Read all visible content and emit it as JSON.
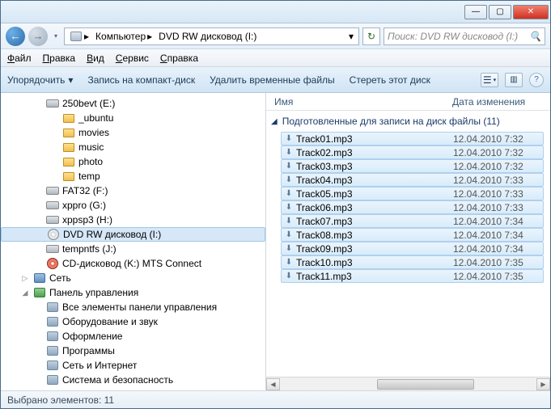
{
  "titlebar": {
    "min": "—",
    "max": "▢",
    "close": "✕"
  },
  "nav": {
    "back": "←",
    "fwd": "→",
    "dd": "▾",
    "sep": "▸",
    "crumb_root_icon": "🖥",
    "crumb1": "Компьютер",
    "crumb2": "DVD RW дисковод (I:)",
    "addr_dd": "▾",
    "refresh": "↻",
    "search_placeholder": "Поиск: DVD RW дисковод (I:)",
    "search_icon": "🔍"
  },
  "menu": {
    "file": "Файл",
    "file_u": "Ф",
    "edit": "Правка",
    "edit_u": "П",
    "view": "Вид",
    "view_u": "В",
    "tools": "Сервис",
    "tools_u": "С",
    "help": "Справка",
    "help_u": "С"
  },
  "toolbar": {
    "organize": "Упорядочить",
    "burn": "Запись на компакт-диск",
    "deltemp": "Удалить временные файлы",
    "erase": "Стереть этот диск",
    "dd": "▾",
    "viewico": "☰",
    "previco": "▥",
    "helpico": "?"
  },
  "tree": [
    {
      "pad": 40,
      "expand": "",
      "iconClass": "i-drive",
      "label": "250bevt (E:)"
    },
    {
      "pad": 60,
      "expand": "",
      "iconClass": "i-fold",
      "label": "_ubuntu"
    },
    {
      "pad": 60,
      "expand": "",
      "iconClass": "i-fold",
      "label": "movies"
    },
    {
      "pad": 60,
      "expand": "",
      "iconClass": "i-fold",
      "label": "music"
    },
    {
      "pad": 60,
      "expand": "",
      "iconClass": "i-fold",
      "label": "photo"
    },
    {
      "pad": 60,
      "expand": "",
      "iconClass": "i-fold",
      "label": "temp"
    },
    {
      "pad": 40,
      "expand": "",
      "iconClass": "i-drive",
      "label": "FAT32 (F:)"
    },
    {
      "pad": 40,
      "expand": "",
      "iconClass": "i-drive",
      "label": "xppro (G:)"
    },
    {
      "pad": 40,
      "expand": "",
      "iconClass": "i-drive",
      "label": "xppsp3 (H:)"
    },
    {
      "pad": 40,
      "expand": "",
      "iconClass": "i-disc",
      "label": "DVD RW дисковод (I:)",
      "sel": true
    },
    {
      "pad": 40,
      "expand": "",
      "iconClass": "i-drive",
      "label": "tempntfs (J:)"
    },
    {
      "pad": 40,
      "expand": "",
      "iconClass": "i-discr",
      "label": "CD-дисковод (K:) MTS Connect"
    },
    {
      "pad": 24,
      "expand": "▷",
      "iconClass": "i-net",
      "label": "Сеть"
    },
    {
      "pad": 24,
      "expand": "◢",
      "iconClass": "i-cp",
      "label": "Панель управления"
    },
    {
      "pad": 40,
      "expand": "",
      "iconClass": "i-gen",
      "label": "Все элементы панели управления"
    },
    {
      "pad": 40,
      "expand": "",
      "iconClass": "i-gen",
      "label": "Оборудование и звук"
    },
    {
      "pad": 40,
      "expand": "",
      "iconClass": "i-gen",
      "label": "Оформление"
    },
    {
      "pad": 40,
      "expand": "",
      "iconClass": "i-gen",
      "label": "Программы"
    },
    {
      "pad": 40,
      "expand": "",
      "iconClass": "i-gen",
      "label": "Сеть и Интернет"
    },
    {
      "pad": 40,
      "expand": "",
      "iconClass": "i-gen",
      "label": "Система и безопасность"
    }
  ],
  "columns": {
    "name": "Имя",
    "date": "Дата изменения"
  },
  "group": {
    "arrow": "◢",
    "label": "Подготовленные для записи на диск файлы (11)"
  },
  "files": [
    {
      "icon": "⬇",
      "name": "Track01.mp3",
      "date": "12.04.2010 7:32"
    },
    {
      "icon": "⬇",
      "name": "Track02.mp3",
      "date": "12.04.2010 7:32"
    },
    {
      "icon": "⬇",
      "name": "Track03.mp3",
      "date": "12.04.2010 7:32"
    },
    {
      "icon": "⬇",
      "name": "Track04.mp3",
      "date": "12.04.2010 7:33"
    },
    {
      "icon": "⬇",
      "name": "Track05.mp3",
      "date": "12.04.2010 7:33"
    },
    {
      "icon": "⬇",
      "name": "Track06.mp3",
      "date": "12.04.2010 7:33"
    },
    {
      "icon": "⬇",
      "name": "Track07.mp3",
      "date": "12.04.2010 7:34"
    },
    {
      "icon": "⬇",
      "name": "Track08.mp3",
      "date": "12.04.2010 7:34"
    },
    {
      "icon": "⬇",
      "name": "Track09.mp3",
      "date": "12.04.2010 7:34"
    },
    {
      "icon": "⬇",
      "name": "Track10.mp3",
      "date": "12.04.2010 7:35"
    },
    {
      "icon": "⬇",
      "name": "Track11.mp3",
      "date": "12.04.2010 7:35"
    }
  ],
  "status": {
    "text": "Выбрано элементов: 11"
  },
  "scroll": {
    "l": "◀",
    "r": "▶"
  }
}
